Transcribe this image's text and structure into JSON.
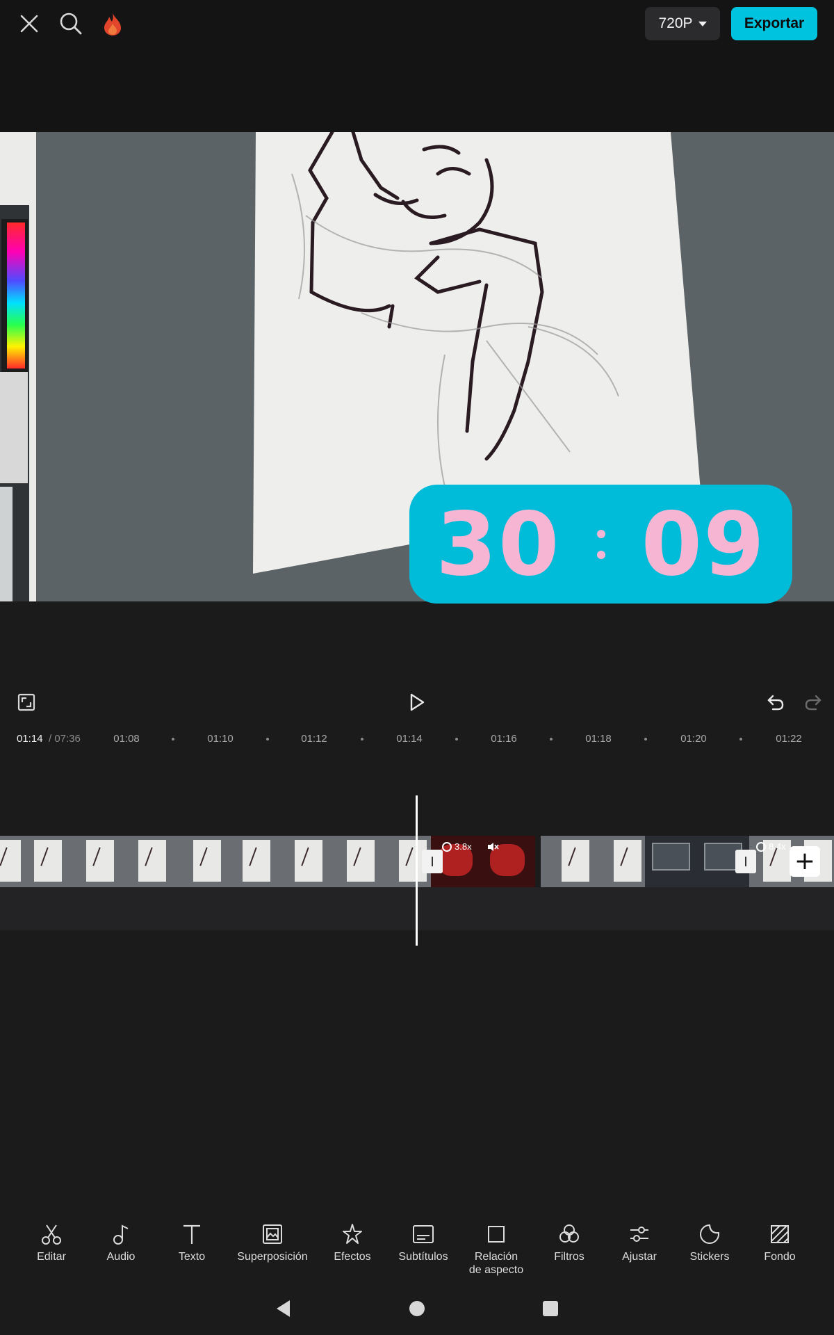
{
  "topbar": {
    "close_icon": "close-icon",
    "search_icon": "search-icon",
    "flame_icon": "flame-icon",
    "resolution": "720P",
    "export_label": "Exportar",
    "accent": "#00c3df"
  },
  "preview": {
    "timer_minutes": "30",
    "timer_seconds": "09",
    "timer_bg": "#00bcd8",
    "timer_fg": "#f7b5d4"
  },
  "controls": {
    "fullscreen_icon": "fullscreen-icon",
    "play_icon": "play-icon",
    "undo_icon": "undo-icon",
    "redo_icon": "redo-icon"
  },
  "ruler": {
    "current": "01:14",
    "total": "/ 07:36",
    "ticks": [
      "01:08",
      "01:10",
      "01:12",
      "01:14",
      "01:16",
      "01:18",
      "01:20",
      "01:22"
    ]
  },
  "timeline": {
    "clip_speed_1": "3.8x",
    "clip_speed_2": "8.4x",
    "add_label": "+"
  },
  "toolbar": {
    "items": [
      {
        "label": "Editar",
        "icon": "scissors-icon"
      },
      {
        "label": "Audio",
        "icon": "music-note-icon"
      },
      {
        "label": "Texto",
        "icon": "text-icon"
      },
      {
        "label": "Superposición",
        "icon": "overlay-icon"
      },
      {
        "label": "Efectos",
        "icon": "effects-star-icon"
      },
      {
        "label": "Subtítulos",
        "icon": "subtitles-icon"
      },
      {
        "label": "Relación\nde aspecto",
        "icon": "aspect-ratio-icon"
      },
      {
        "label": "Filtros",
        "icon": "filters-icon"
      },
      {
        "label": "Ajustar",
        "icon": "adjust-sliders-icon"
      },
      {
        "label": "Stickers",
        "icon": "sticker-icon"
      },
      {
        "label": "Fondo",
        "icon": "background-icon"
      }
    ]
  },
  "system_nav": {
    "back_icon": "back-triangle-icon",
    "home_icon": "home-circle-icon",
    "recents_icon": "recents-square-icon"
  }
}
